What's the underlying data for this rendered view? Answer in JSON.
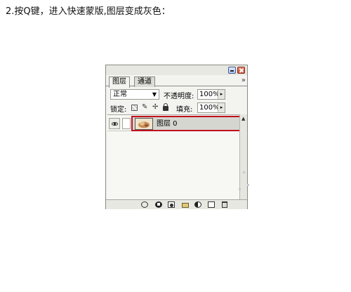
{
  "instruction": "2.按Q键，进入快速蒙版,图层变成灰色：",
  "panel": {
    "tabs": [
      "图层",
      "通道"
    ],
    "panel_menu": "»",
    "blend_mode": "正常",
    "blend_arrow": "▼",
    "opacity_label": "不透明度:",
    "opacity_value": "100%",
    "lock_label": "锁定:",
    "fill_label": "填充:",
    "fill_value": "100%",
    "stepper_glyph": "▸",
    "lock_paint_glyph": "✎",
    "lock_move_glyph": "✢",
    "scroll_up_glyph": "▲",
    "layers": [
      {
        "name": "图层 0",
        "visible": true,
        "selected": true
      }
    ],
    "colors": {
      "selection_outline": "#c2101c",
      "layer_grey": "#d6d6d0"
    },
    "bottom_icons": [
      "link-layers-icon",
      "layer-style-icon",
      "layer-mask-icon",
      "new-group-icon",
      "adjustment-layer-icon",
      "new-layer-icon",
      "trash-icon"
    ]
  }
}
